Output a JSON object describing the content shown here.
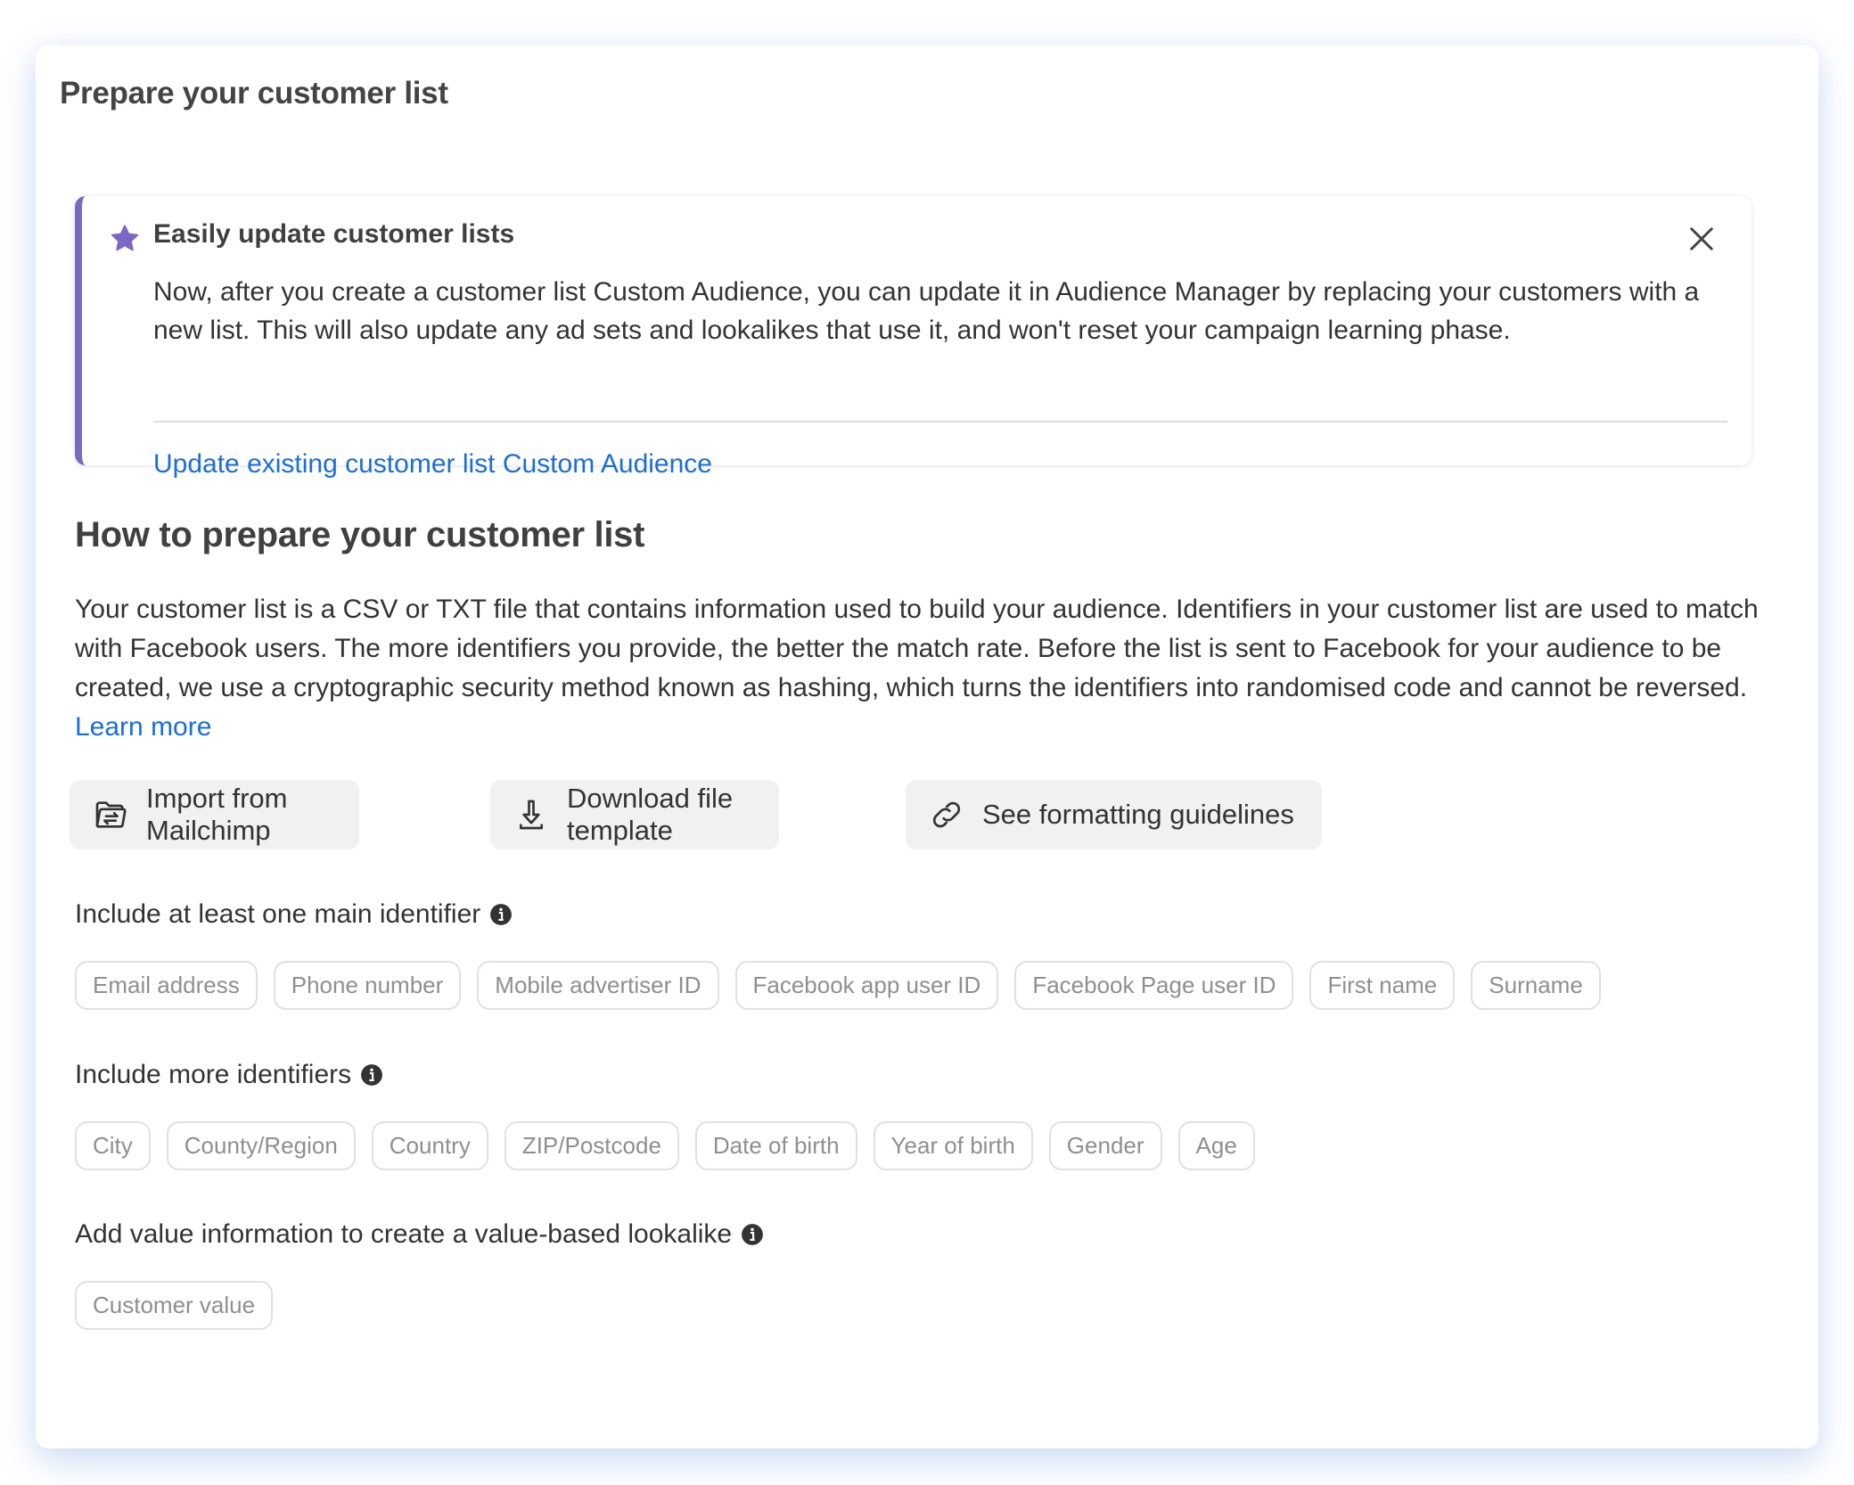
{
  "page": {
    "title": "Prepare your customer list"
  },
  "banner": {
    "icon": "star-icon",
    "title": "Easily update customer lists",
    "body": "Now, after you create a customer list Custom Audience, you can update it in Audience Manager by replacing your customers with a new list. This will also update any ad sets and lookalikes that use it, and won't reset your campaign learning phase.",
    "link": "Update existing customer list Custom Audience",
    "close_icon": "close-icon",
    "accent_color": "#7b68c4"
  },
  "section": {
    "heading": "How to prepare your customer list",
    "description": "Your customer list is a CSV or TXT file that contains information used to build your audience. Identifiers in your customer list are used to match with Facebook users. The more identifiers you provide, the better the match rate. Before the list is sent to Facebook for your audience to be created, we use a cryptographic security method known as hashing, which turns the identifiers into randomised code and cannot be reversed.",
    "learn_more": "Learn more",
    "link_color": "#1a6ed8"
  },
  "actions": [
    {
      "label": "Import from Mailchimp",
      "icon": "folder-transfer-icon"
    },
    {
      "label": "Download file template",
      "icon": "download-icon"
    },
    {
      "label": "See formatting guidelines",
      "icon": "link-icon"
    }
  ],
  "groups": {
    "main": {
      "label": "Include at least one main identifier",
      "chips": [
        "Email address",
        "Phone number",
        "Mobile advertiser ID",
        "Facebook app user ID",
        "Facebook Page user ID",
        "First name",
        "Surname"
      ]
    },
    "more": {
      "label": "Include more identifiers",
      "chips": [
        "City",
        "County/Region",
        "Country",
        "ZIP/Postcode",
        "Date of birth",
        "Year of birth",
        "Gender",
        "Age"
      ]
    },
    "value": {
      "label": "Add value information to create a value-based lookalike",
      "chips": [
        "Customer value"
      ]
    }
  }
}
